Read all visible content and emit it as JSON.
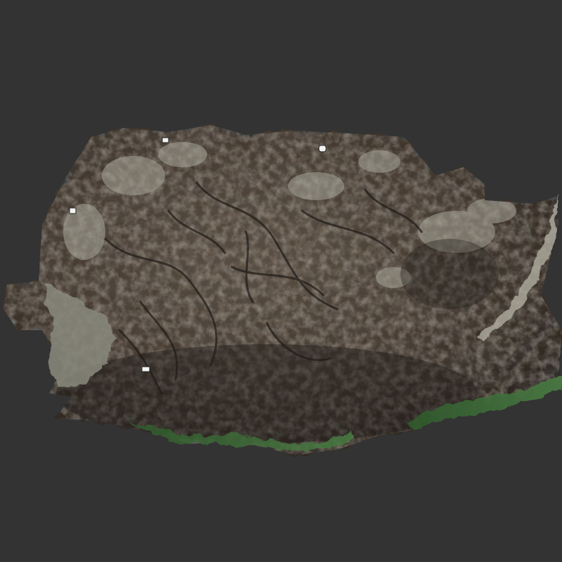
{
  "viewer": {
    "background": "#333333"
  },
  "model": {
    "subject": "photogrammetry-rock-scan",
    "palette": {
      "rock_dark": "#2e2a25",
      "rock_mid": "#4a4035",
      "rock_brown": "#5a4a3a",
      "lichen": "#9a9a8c",
      "moss": "#3f6b3a",
      "shadow": "#1e1b18"
    },
    "markers": [
      {
        "name": "ground-control-marker"
      },
      {
        "name": "ground-control-marker"
      },
      {
        "name": "ground-control-marker"
      },
      {
        "name": "ground-control-marker"
      }
    ]
  }
}
